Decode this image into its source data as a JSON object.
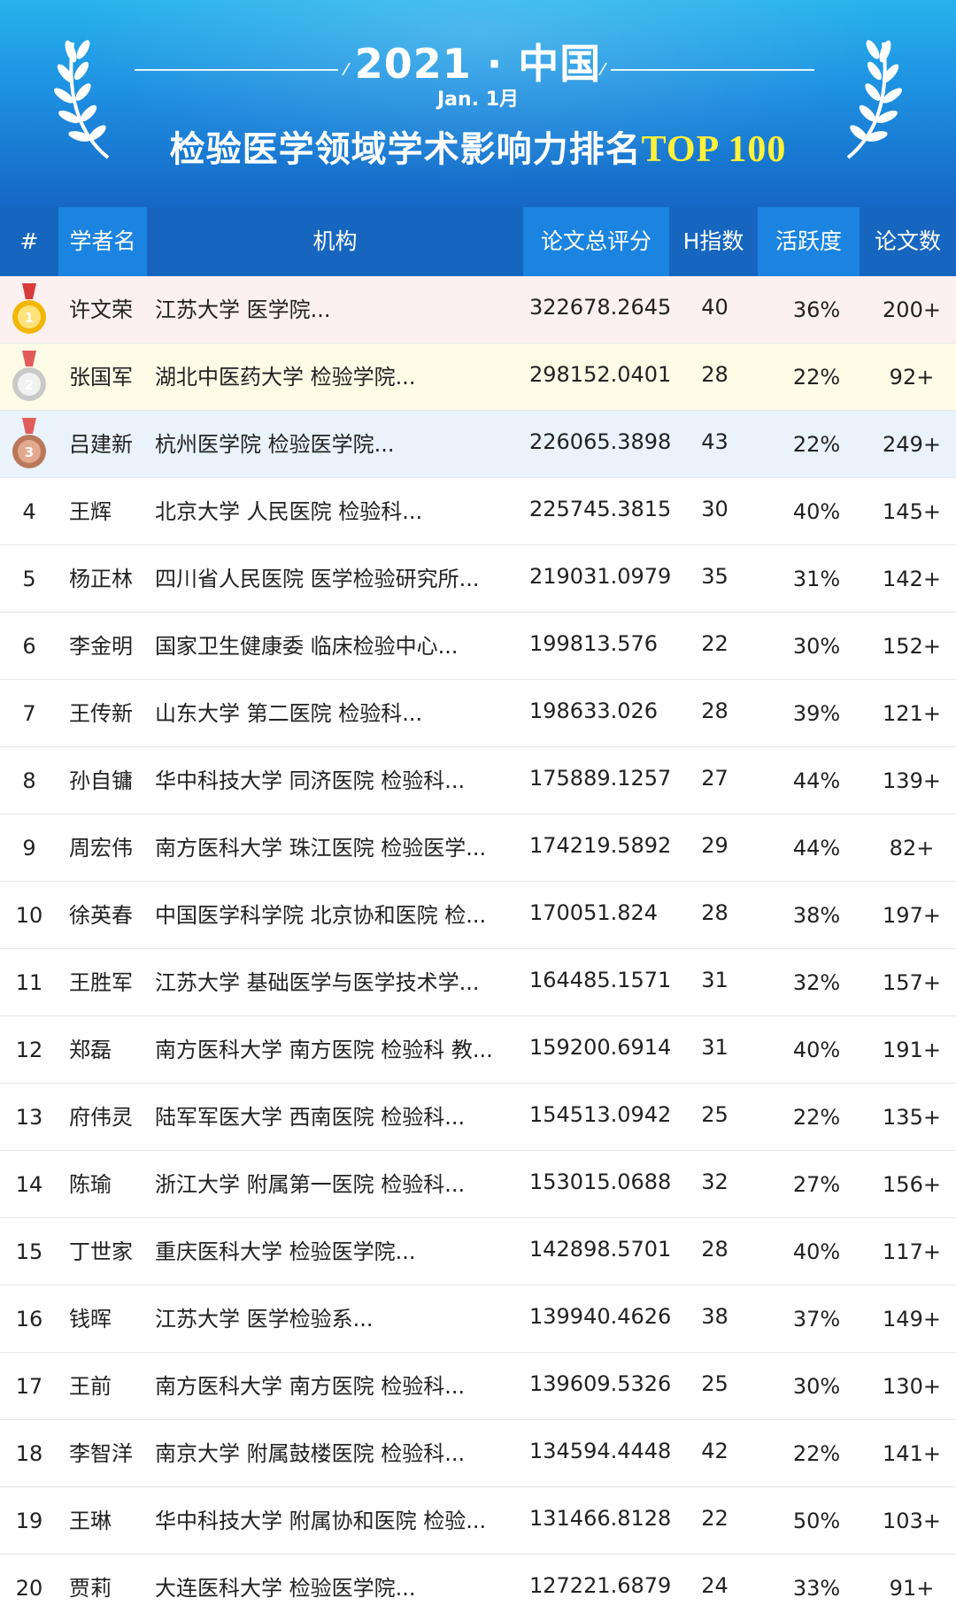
{
  "header": {
    "year_title": "2021 · 中国",
    "month": "Jan.  1月",
    "main_title": "检验医学领域学术影响力排名",
    "main_title_highlight": "TOP 100"
  },
  "columns": {
    "rank": "#",
    "name": "学者名",
    "institution": "机构",
    "score": "论文总评分",
    "h_index": "H指数",
    "activity": "活跃度",
    "papers": "论文数"
  },
  "colors": {
    "header_gradient_top": "#27b3ec",
    "header_gradient_bottom": "#1667c6",
    "table_header": "#1b84e0",
    "table_header_dark": "#1666c0",
    "highlight_text": "#fff23a",
    "row1_bg": "#fdf0f0",
    "row2_bg": "#fefbe6",
    "row3_bg": "#eaf2fb",
    "gold": "#f2b705",
    "silver": "#c9c9c9",
    "bronze": "#b9785a"
  },
  "rows": [
    {
      "rank": "1",
      "medal": "gold-medal-icon",
      "name": "许文荣",
      "institution": "江苏大学 医学院...",
      "score": "322678.2645",
      "h": "40",
      "activity": "36%",
      "papers": "200+"
    },
    {
      "rank": "2",
      "medal": "silver-medal-icon",
      "name": "张国军",
      "institution": "湖北中医药大学 检验学院...",
      "score": "298152.0401",
      "h": "28",
      "activity": "22%",
      "papers": "92+"
    },
    {
      "rank": "3",
      "medal": "bronze-medal-icon",
      "name": "吕建新",
      "institution": "杭州医学院 检验医学院...",
      "score": "226065.3898",
      "h": "43",
      "activity": "22%",
      "papers": "249+"
    },
    {
      "rank": "4",
      "name": "王辉",
      "institution": "北京大学 人民医院 检验科...",
      "score": "225745.3815",
      "h": "30",
      "activity": "40%",
      "papers": "145+"
    },
    {
      "rank": "5",
      "name": "杨正林",
      "institution": "四川省人民医院 医学检验研究所...",
      "score": "219031.0979",
      "h": "35",
      "activity": "31%",
      "papers": "142+"
    },
    {
      "rank": "6",
      "name": "李金明",
      "institution": "国家卫生健康委 临床检验中心...",
      "score": "199813.576",
      "h": "22",
      "activity": "30%",
      "papers": "152+"
    },
    {
      "rank": "7",
      "name": "王传新",
      "institution": "山东大学 第二医院 检验科...",
      "score": "198633.026",
      "h": "28",
      "activity": "39%",
      "papers": "121+"
    },
    {
      "rank": "8",
      "name": "孙自镛",
      "institution": "华中科技大学 同济医院 检验科...",
      "score": "175889.1257",
      "h": "27",
      "activity": "44%",
      "papers": "139+"
    },
    {
      "rank": "9",
      "name": "周宏伟",
      "institution": "南方医科大学 珠江医院 检验医学...",
      "score": "174219.5892",
      "h": "29",
      "activity": "44%",
      "papers": "82+"
    },
    {
      "rank": "10",
      "name": "徐英春",
      "institution": "中国医学科学院 北京协和医院 检...",
      "score": "170051.824",
      "h": "28",
      "activity": "38%",
      "papers": "197+"
    },
    {
      "rank": "11",
      "name": "王胜军",
      "institution": "江苏大学 基础医学与医学技术学...",
      "score": "164485.1571",
      "h": "31",
      "activity": "32%",
      "papers": "157+"
    },
    {
      "rank": "12",
      "name": "郑磊",
      "institution": "南方医科大学 南方医院 检验科 教...",
      "score": "159200.6914",
      "h": "31",
      "activity": "40%",
      "papers": "191+"
    },
    {
      "rank": "13",
      "name": "府伟灵",
      "institution": "陆军军医大学 西南医院 检验科...",
      "score": "154513.0942",
      "h": "25",
      "activity": "22%",
      "papers": "135+"
    },
    {
      "rank": "14",
      "name": "陈瑜",
      "institution": "浙江大学 附属第一医院 检验科...",
      "score": "153015.0688",
      "h": "32",
      "activity": "27%",
      "papers": "156+"
    },
    {
      "rank": "15",
      "name": "丁世家",
      "institution": "重庆医科大学 检验医学院...",
      "score": "142898.5701",
      "h": "28",
      "activity": "40%",
      "papers": "117+"
    },
    {
      "rank": "16",
      "name": "钱晖",
      "institution": "江苏大学 医学检验系...",
      "score": "139940.4626",
      "h": "38",
      "activity": "37%",
      "papers": "149+"
    },
    {
      "rank": "17",
      "name": "王前",
      "institution": "南方医科大学 南方医院 检验科...",
      "score": "139609.5326",
      "h": "25",
      "activity": "30%",
      "papers": "130+"
    },
    {
      "rank": "18",
      "name": "李智洋",
      "institution": "南京大学 附属鼓楼医院 检验科...",
      "score": "134594.4448",
      "h": "42",
      "activity": "22%",
      "papers": "141+"
    },
    {
      "rank": "19",
      "name": "王琳",
      "institution": "华中科技大学 附属协和医院 检验...",
      "score": "131466.8128",
      "h": "22",
      "activity": "50%",
      "papers": "103+"
    },
    {
      "rank": "20",
      "name": "贾莉",
      "institution": "大连医科大学 检验医学院...",
      "score": "127221.6879",
      "h": "24",
      "activity": "33%",
      "papers": "91+"
    }
  ]
}
